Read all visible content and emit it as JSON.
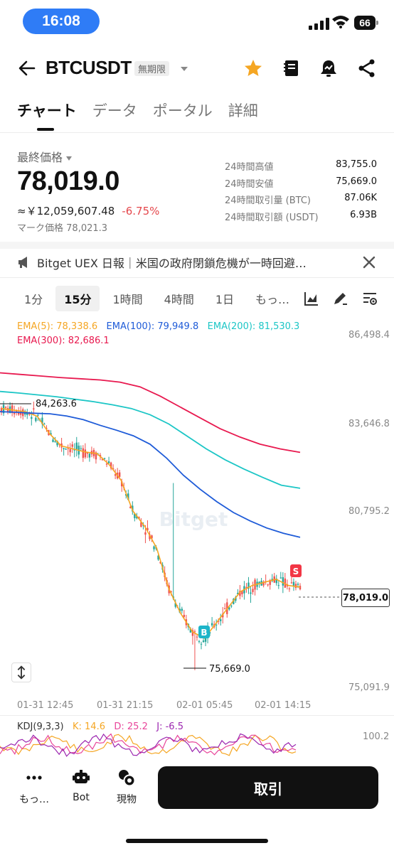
{
  "status_bar": {
    "time": "16:08",
    "battery": "66"
  },
  "header": {
    "symbol": "BTCUSDT",
    "contract_type": "無期限"
  },
  "tabs": [
    {
      "label": "チャート",
      "active": true
    },
    {
      "label": "データ",
      "active": false
    },
    {
      "label": "ポータル",
      "active": false
    },
    {
      "label": "詳細",
      "active": false
    }
  ],
  "price": {
    "label": "最終価格",
    "last": "78,019.0",
    "fiat": "≈￥12,059,607.48",
    "change": "-6.75%",
    "mark_label": "マーク価格",
    "mark": "78,021.3"
  },
  "stats": [
    {
      "label": "24時間高値",
      "value": "83,755.0"
    },
    {
      "label": "24時間安値",
      "value": "75,669.0"
    },
    {
      "label": "24時間取引量 (BTC)",
      "value": "87.06K"
    },
    {
      "label": "24時間取引額 (USDT)",
      "value": "6.93B"
    }
  ],
  "news": {
    "text": "Bitget UEX 日報｜米国の政府閉鎖危機が一時回避…"
  },
  "intervals": [
    {
      "label": "1分",
      "active": false
    },
    {
      "label": "15分",
      "active": true
    },
    {
      "label": "1時間",
      "active": false
    },
    {
      "label": "4時間",
      "active": false
    },
    {
      "label": "1日",
      "active": false
    },
    {
      "label": "もっ…",
      "active": false
    }
  ],
  "ema": [
    {
      "text": "EMA(5): 78,338.6",
      "color": "#f5a623"
    },
    {
      "text": "EMA(100): 79,949.8",
      "color": "#1e5bd8"
    },
    {
      "text": "EMA(200): 81,530.3",
      "color": "#1cc6c6"
    },
    {
      "text": "EMA(300): 82,686.1",
      "color": "#e8194f"
    }
  ],
  "chart_data": {
    "type": "candlestick",
    "y_ticks": [
      "86,498.4",
      "83,646.8",
      "80,795.2",
      "75,091.9"
    ],
    "x_ticks": [
      "01-31 12:45",
      "01-31 21:15",
      "02-01 05:45",
      "02-01 14:15"
    ],
    "ylim": [
      75091.9,
      86498.4
    ],
    "high_annotation": "84,263.6",
    "low_annotation": "75,669.0",
    "current_price": "78,019.0",
    "markers": [
      {
        "label": "B",
        "color": "#1cb5c9"
      },
      {
        "label": "S",
        "color": "#f23645"
      }
    ],
    "watermark": "Bitget",
    "ema_series": {
      "ema5": [
        84100,
        84050,
        84000,
        83850,
        83300,
        82900,
        82800,
        82700,
        82650,
        82300,
        81800,
        80800,
        80300,
        79600,
        78300,
        77500,
        76900,
        76700,
        77200,
        77700,
        78200,
        78400,
        78500,
        78600,
        78400,
        78350
      ],
      "ema100": [
        84000,
        83980,
        83950,
        83930,
        83860,
        83740,
        83560,
        83400,
        83220,
        82950,
        82500,
        81950,
        81500,
        81100,
        80750,
        80480,
        80250,
        80080,
        79950
      ],
      "ema200": [
        84650,
        84600,
        84540,
        84480,
        84400,
        84320,
        84220,
        84100,
        83900,
        83600,
        83200,
        82800,
        82450,
        82150,
        81880,
        81630,
        81530
      ],
      "ema300": [
        85250,
        85200,
        85150,
        85100,
        85060,
        85020,
        84950,
        84800,
        84500,
        84150,
        83800,
        83450,
        83180,
        82950,
        82800,
        82686
      ]
    }
  },
  "kdj": {
    "label": "KDJ(9,3,3)",
    "k": "K: 14.6",
    "d": "D: 25.2",
    "j": "J: -6.5",
    "k_color": "#f5a623",
    "d_color": "#e8459a",
    "j_color": "#9c27b0",
    "y_tick": "100.2"
  },
  "bottom_bar": {
    "more": "もっ…",
    "bot": "Bot",
    "spot": "現物",
    "trade": "取引"
  }
}
